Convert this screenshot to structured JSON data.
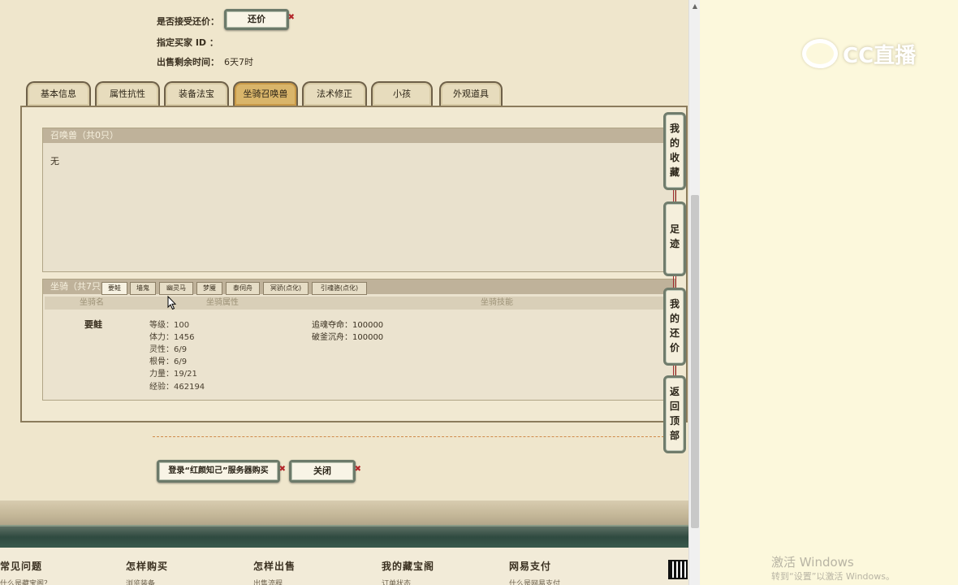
{
  "offer": {
    "accept_label": "是否接受还价：",
    "counter_button": "还价",
    "buyer_id_label": "指定买家 ID ：",
    "remaining_label": "出售剩余时间：",
    "remaining_value": "6天7时"
  },
  "tabs": [
    {
      "label": "基本信息",
      "active": false
    },
    {
      "label": "属性抗性",
      "active": false
    },
    {
      "label": "装备法宝",
      "active": false
    },
    {
      "label": "坐骑召唤兽",
      "active": true
    },
    {
      "label": "法术修正",
      "active": false
    },
    {
      "label": "小孩",
      "active": false
    },
    {
      "label": "外观道具",
      "active": false
    }
  ],
  "summon": {
    "header": "召唤兽（共0只）",
    "empty_text": "无"
  },
  "mounts": {
    "header": "坐骑（共7只）",
    "tabs": [
      "要鲑",
      "墙鬼",
      "幽灵马",
      "梦魇",
      "泰伺舟",
      "冥骄(点化)",
      "引魂骆(点化)"
    ],
    "columns": [
      "坐骑名",
      "坐骑属性",
      "坐骑技能"
    ],
    "selected": {
      "name": "要鲑",
      "attributes": [
        "等级：100",
        "体力：1456",
        "灵性：6/9",
        "根骨：6/9",
        "力量：19/21",
        "经验：462194"
      ],
      "skills": [
        "追魂夺命：100000",
        "破釜沉舟：100000"
      ]
    }
  },
  "actions": {
    "login_buy": "登录“红颜知己”服务器购买",
    "close": "关闭"
  },
  "side_buttons": [
    {
      "label": "我的收藏"
    },
    {
      "label": "足迹"
    },
    {
      "label": "我的还价"
    },
    {
      "label": "返回顶部"
    }
  ],
  "footer": {
    "columns": [
      {
        "title": "常见问题",
        "link": "什么是藏宝阁？"
      },
      {
        "title": "怎样购买",
        "link": "浏览装备"
      },
      {
        "title": "怎样出售",
        "link": "出售流程"
      },
      {
        "title": "我的藏宝阁",
        "link": "订单状态"
      },
      {
        "title": "网易支付",
        "link": "什么是网易支付"
      }
    ]
  },
  "watermark": {
    "logo_text": "CC直播",
    "activate_title": "激活 Windows",
    "activate_sub": "转到“设置”以激活 Windows。"
  }
}
